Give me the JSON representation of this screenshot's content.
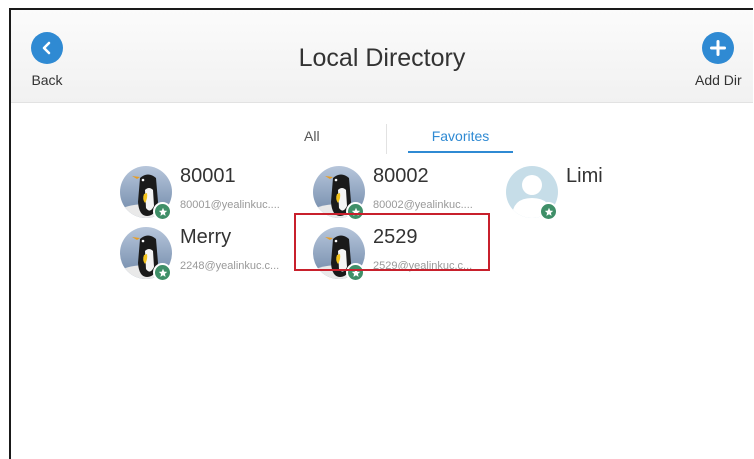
{
  "header": {
    "back_label": "Back",
    "title": "Local Directory",
    "add_label": "Add Dir"
  },
  "tabs": [
    {
      "label": "All",
      "selected": false
    },
    {
      "label": "Favorites",
      "selected": true
    }
  ],
  "contacts": [
    {
      "name": "80001",
      "uri": "80001@yealinkuc....",
      "avatar": "penguin",
      "favorite": true
    },
    {
      "name": "80002",
      "uri": "80002@yealinkuc....",
      "avatar": "penguin",
      "favorite": true
    },
    {
      "name": "Limi",
      "uri": "",
      "avatar": "default-person",
      "favorite": true
    },
    {
      "name": "Merry",
      "uri": "2248@yealinkuc.c...",
      "avatar": "penguin",
      "favorite": true
    },
    {
      "name": "2529",
      "uri": "2529@yealinkuc.c...",
      "avatar": "penguin",
      "favorite": true,
      "highlighted": true
    }
  ],
  "colors": {
    "accent": "#2f8ad3",
    "highlight_border": "#c8202c",
    "favorite_badge": "#3f8f68"
  },
  "icons": {
    "back": "chevron-left-icon",
    "add": "plus-icon",
    "favorite": "star-icon"
  }
}
